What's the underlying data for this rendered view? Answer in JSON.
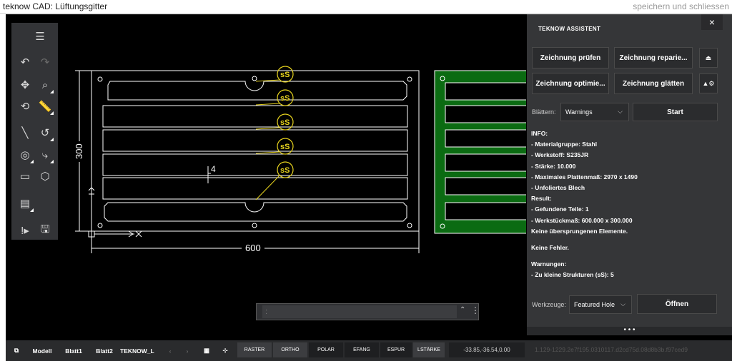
{
  "window": {
    "title": "teknow CAD: Lüftungsgitter",
    "save_close": "speichern und schliessen"
  },
  "toolbar": {
    "icons": [
      "menu-icon",
      "undo-icon",
      "redo-icon",
      "pan-icon",
      "zoom-icon",
      "rotate-icon",
      "measure-icon",
      "line-icon",
      "arc-icon",
      "circle-icon",
      "polyline-icon",
      "rectangle-icon",
      "polygon-icon",
      "notes-icon",
      "warning-icon",
      "save-icon"
    ]
  },
  "drawing": {
    "dim_height": "300",
    "dim_width": "600",
    "dim_small": "4",
    "marker_label": "sS",
    "colors": {
      "outline": "#ffffff",
      "marker": "#e6d21e",
      "part_fill": "#0b6b12"
    }
  },
  "command": {
    "placeholder": ":"
  },
  "assistant": {
    "title": "TEKNOW ASSISTENT",
    "close": "×",
    "buttons": {
      "check": "Zeichnung prüfen",
      "repair": "Zeichnung reparie...",
      "optimize": "Zeichnung optimie...",
      "smooth": "Zeichnung glätten"
    },
    "browse_label": "Blättern:",
    "browse_value": "Warnings",
    "start": "Start",
    "info_lines": [
      "INFO:",
      "- Materialgruppe: Stahl",
      "- Werkstoff: S235JR",
      "- Stärke: 10.000",
      "- Maximales Plattenmaß: 2970 x 1490",
      "- Unfoliertes Blech",
      "Result:",
      "- Gefundene Teile: 1",
      "- Werkstückmaß: 600.000 x 300.000",
      "Keine übersprungenen Elemente."
    ],
    "no_errors": "Keine Fehler.",
    "warnings_title": "Warnungen:",
    "warnings_line": "- Zu kleine Strukturen (sS): 5",
    "tools_label": "Werkzeuge:",
    "tools_value": "Featured Hole",
    "open": "Öffnen",
    "grip": "• • •"
  },
  "statusbar": {
    "tabs": [
      "Modell",
      "Blatt1",
      "Blatt2",
      "TEKNOW_L"
    ],
    "toggles": [
      {
        "label": "RASTER",
        "on": true
      },
      {
        "label": "ORTHO",
        "on": true
      },
      {
        "label": "POLAR",
        "on": false
      },
      {
        "label": "EFANG",
        "on": false
      },
      {
        "label": "ESPUR",
        "on": false
      },
      {
        "label": "LSTÄRKE",
        "on": true
      }
    ],
    "coords": "-33.85,-36.54,0.00",
    "hash": "1.129-1229.2e7f195.0310117.d2cd75d.08d8b3b.f97ced9"
  }
}
